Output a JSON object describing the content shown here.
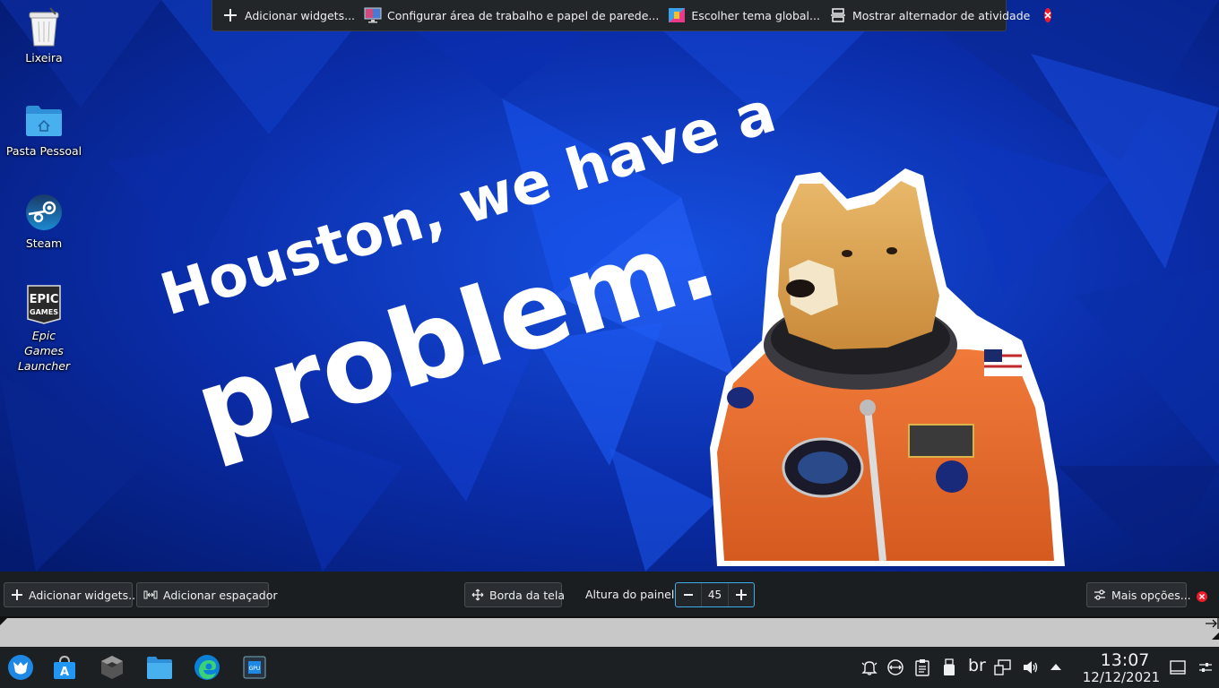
{
  "top_toolbar": {
    "add_widgets": "Adicionar widgets...",
    "configure_desktop": "Configurar área de trabalho e papel de parede...",
    "global_theme": "Escolher tema global...",
    "activity_switcher": "Mostrar alternador de atividade"
  },
  "desktop_icons": [
    {
      "label": "Lixeira",
      "icon": "trash-icon"
    },
    {
      "label": "Pasta Pessoal",
      "icon": "home-folder-icon"
    },
    {
      "label": "Steam",
      "icon": "steam-icon"
    },
    {
      "label": "Epic Games Launcher",
      "icon": "epic-games-icon"
    }
  ],
  "wallpaper": {
    "line1": "Houston, we have a",
    "line2": "problem."
  },
  "panel_config": {
    "add_widgets": "Adicionar widgets...",
    "add_spacer": "Adicionar espaçador",
    "screen_edge": "Borda da tela",
    "panel_height_label": "Altura do painel:",
    "panel_height_value": "45",
    "more_options": "Mais opções..."
  },
  "taskbar": {
    "apps": [
      "app-launcher-icon",
      "discover-store-icon",
      "gamecube-emulator-icon",
      "file-manager-icon",
      "edge-browser-icon",
      "gpu-monitor-icon"
    ],
    "tray": [
      "notifications-icon",
      "kde-connect-icon",
      "clipboard-icon",
      "usb-device-icon"
    ],
    "keyboard_layout": "br",
    "clock_time": "13:07",
    "clock_date": "12/12/2021"
  },
  "colors": {
    "wallpaper_base": "#06208a",
    "panel_bg": "#1b1e20",
    "accent": "#3daee9",
    "close_red": "#ed1c2a",
    "ruler": "#c8c8c8"
  }
}
